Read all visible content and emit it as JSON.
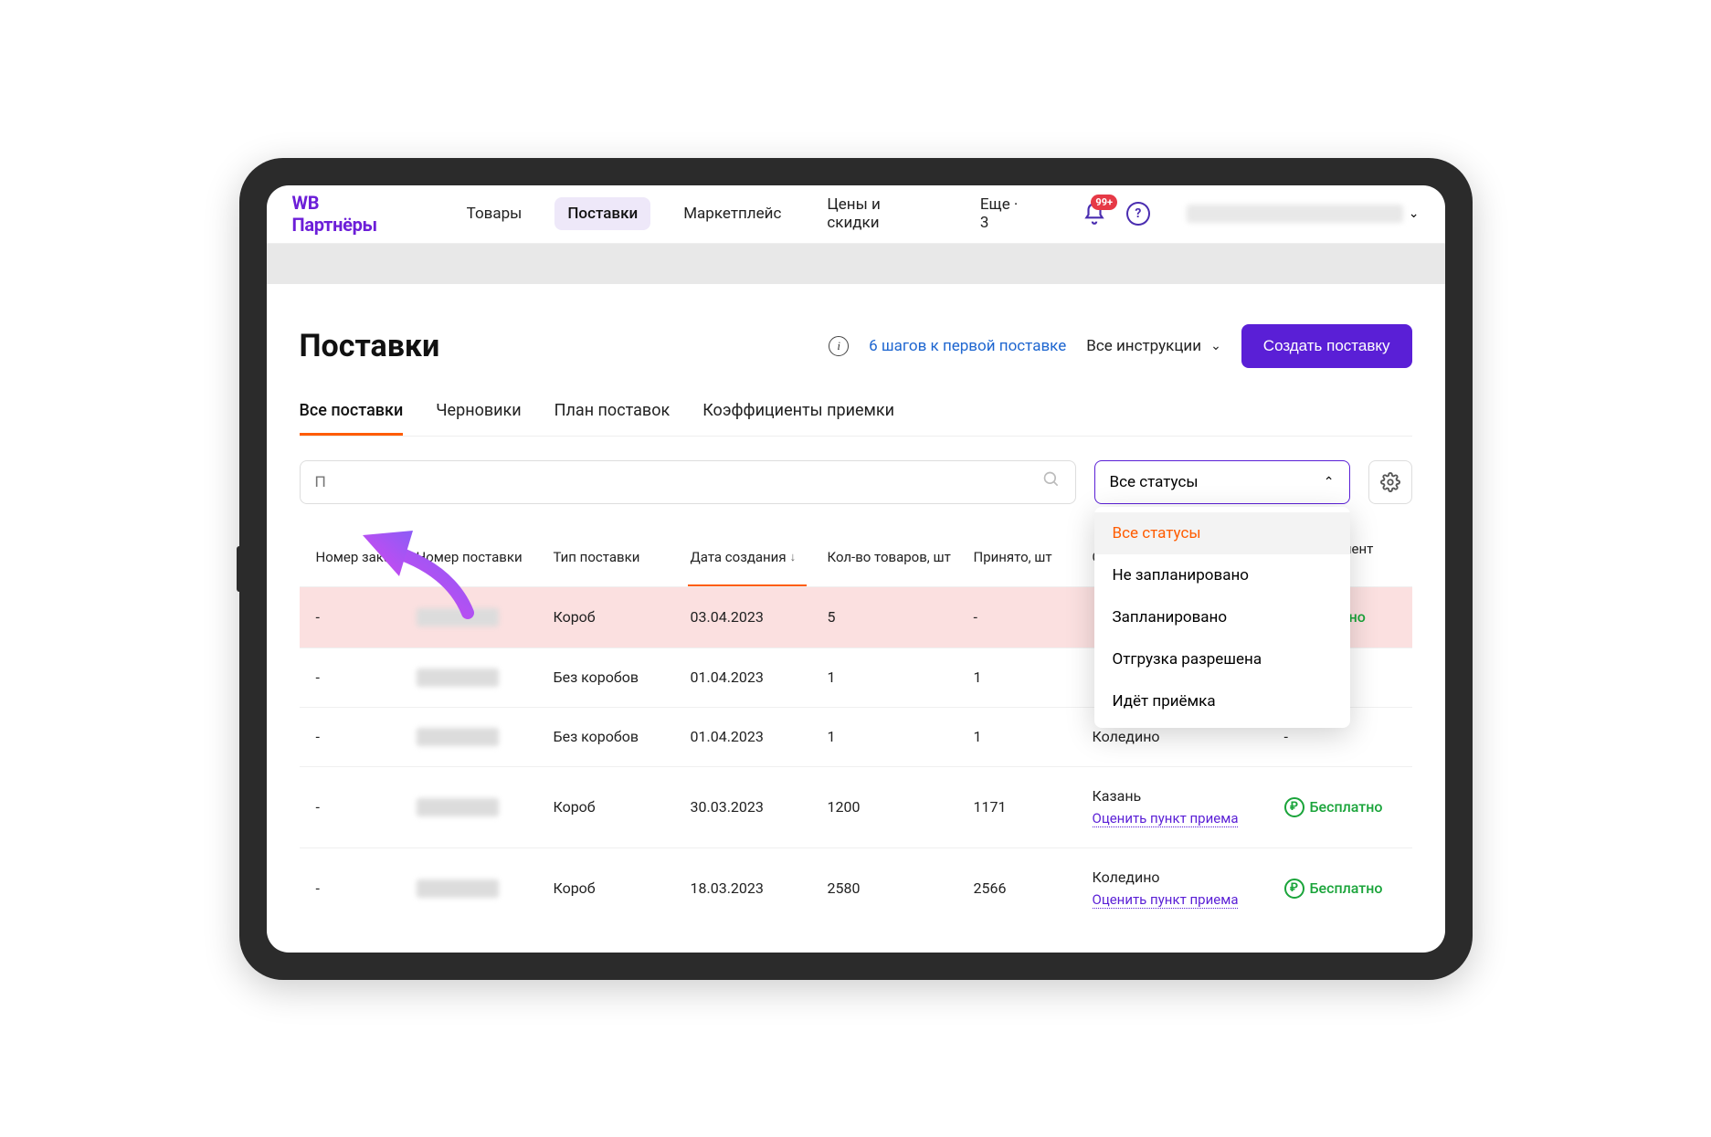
{
  "logo": "WB Партнёры",
  "nav": {
    "items": [
      "Товары",
      "Поставки",
      "Маркетплейс",
      "Цены и скидки",
      "Еще · 3"
    ],
    "active_index": 1,
    "notification_badge": "99+"
  },
  "page": {
    "title": "Поставки",
    "steps_link": "6 шагов к первой поставке",
    "instructions": "Все инструкции",
    "create_button": "Создать поставку"
  },
  "tabs": {
    "items": [
      "Все поставки",
      "Черновики",
      "План поставок",
      "Коэффициенты приемки"
    ],
    "active_index": 0
  },
  "search": {
    "placeholder": "П"
  },
  "status_filter": {
    "label": "Все статусы",
    "options": [
      "Все статусы",
      "Не запланировано",
      "Запланировано",
      "Отгрузка разрешена",
      "Идёт приёмка"
    ],
    "selected_index": 0
  },
  "columns": [
    "Номер заказа",
    "Номер поставки",
    "Тип поставки",
    "Дата создания",
    "Кол-во товаров, шт",
    "Принято, шт",
    "Склад",
    "Коэффициент приемки"
  ],
  "sorted_column_index": 3,
  "rows": [
    {
      "order": "-",
      "type": "Короб",
      "date": "03.04.2023",
      "qty": "5",
      "accepted": "-",
      "warehouse": "",
      "rate_link": "",
      "coef": "сплатно",
      "free": true,
      "highlight": true
    },
    {
      "order": "-",
      "type": "Без коробов",
      "date": "01.04.2023",
      "qty": "1",
      "accepted": "1",
      "warehouse": "",
      "rate_link": "",
      "coef": "",
      "free": false,
      "highlight": false
    },
    {
      "order": "-",
      "type": "Без коробов",
      "date": "01.04.2023",
      "qty": "1",
      "accepted": "1",
      "warehouse": "Коледино",
      "rate_link": "",
      "coef": "-",
      "free": false,
      "highlight": false
    },
    {
      "order": "-",
      "type": "Короб",
      "date": "30.03.2023",
      "qty": "1200",
      "accepted": "1171",
      "warehouse": "Казань",
      "rate_link": "Оценить пункт приема",
      "coef": "Бесплатно",
      "free": true,
      "highlight": false
    },
    {
      "order": "-",
      "type": "Короб",
      "date": "18.03.2023",
      "qty": "2580",
      "accepted": "2566",
      "warehouse": "Коледино",
      "rate_link": "Оценить пункт приема",
      "coef": "Бесплатно",
      "free": true,
      "highlight": false
    }
  ],
  "labels": {
    "ruble": "₽"
  }
}
